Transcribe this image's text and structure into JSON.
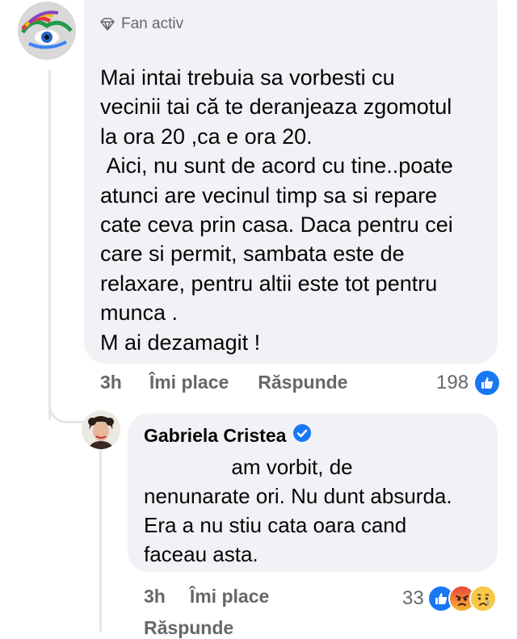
{
  "comment": {
    "badge": "Fan activ",
    "text": "Mai intai trebuia sa vorbesti cu\nvecinii tai că te deranjeaza zgomotul\nla ora 20 ,ca e ora 20.\n Aici, nu sunt de acord cu tine..poate\natunci are vecinul timp sa si repare\ncate ceva prin casa. Daca pentru cei\ncare si permit, sambata este de\nrelaxare, pentru altii este tot pentru\nmunca .\nM ai dezamagit !",
    "time": "3h",
    "like_label": "Îmi place",
    "reply_label": "Răspunde",
    "reaction_count": "198",
    "reactions": [
      "like-icon"
    ]
  },
  "reply": {
    "author": "Gabriela Cristea",
    "verified": true,
    "text": "               am vorbit, de\nnenunarate ori. Nu dunt absurda.\nEra a nu stiu cata oara cand\nfaceau asta.",
    "time": "3h",
    "like_label": "Îmi place",
    "reply_label": "Răspunde",
    "reaction_count": "33",
    "reactions": [
      "like-icon",
      "angry-icon",
      "sad-icon"
    ]
  },
  "colors": {
    "bubble": "#f0f2f5",
    "meta": "#65676b",
    "accent": "#1877f2"
  }
}
